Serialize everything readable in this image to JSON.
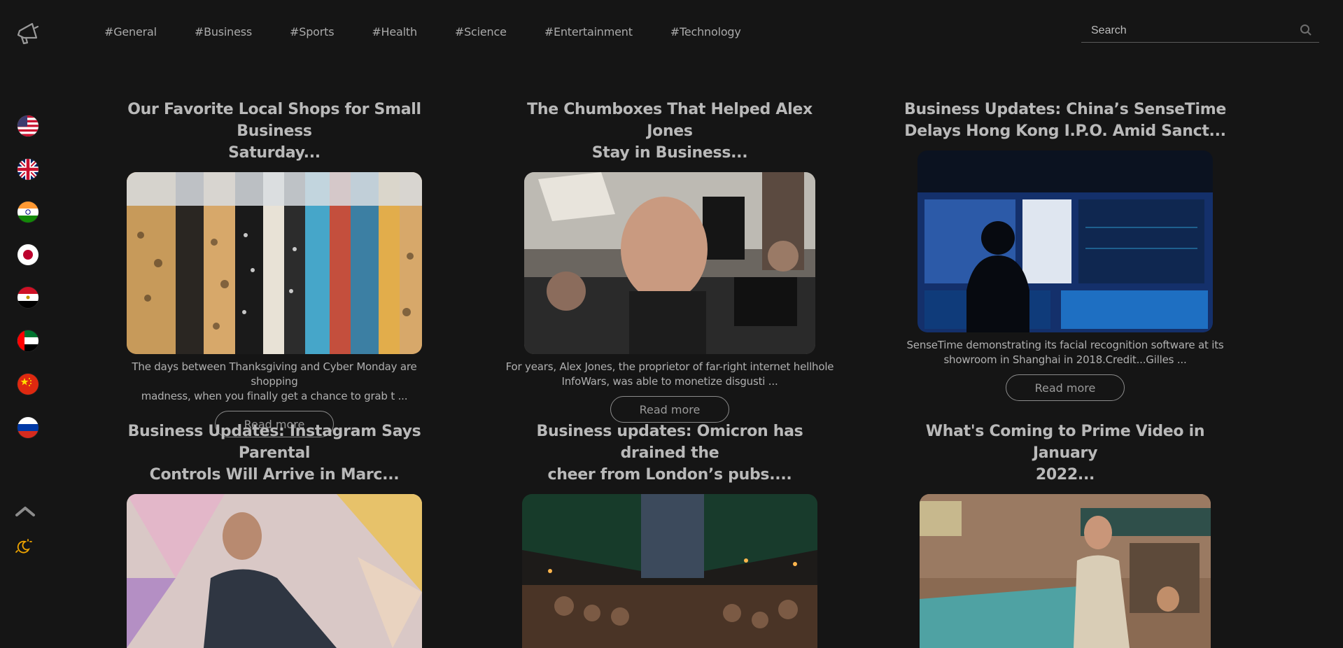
{
  "nav": {
    "logo_icon": "megaphone-icon",
    "categories": [
      "#General",
      "#Business",
      "#Sports",
      "#Health",
      "#Science",
      "#Entertainment",
      "#Technology"
    ]
  },
  "search": {
    "placeholder": "Search",
    "value": "",
    "icon": "search-icon"
  },
  "sidebar": {
    "countries": [
      {
        "code": "us",
        "icon": "flag-us-icon"
      },
      {
        "code": "gb",
        "icon": "flag-uk-icon"
      },
      {
        "code": "in",
        "icon": "flag-india-icon"
      },
      {
        "code": "jp",
        "icon": "flag-japan-icon"
      },
      {
        "code": "eg",
        "icon": "flag-egypt-icon"
      },
      {
        "code": "ae",
        "icon": "flag-uae-icon"
      },
      {
        "code": "cn",
        "icon": "flag-china-icon"
      },
      {
        "code": "ru",
        "icon": "flag-russia-icon"
      }
    ],
    "scroll_top_icon": "chevron-up-icon",
    "theme_toggle_icon": "moon-sun-icon"
  },
  "articles": [
    {
      "title_line1": "Our Favorite Local Shops for Small Business",
      "title_line2": "Saturday...",
      "desc_line1": "The days between Thanksgiving and Cyber Monday are shopping",
      "desc_line2": "madness, when you finally get a chance to grab t ...",
      "read_more": "Read more",
      "image": "clothing-rack-image"
    },
    {
      "title_line1": "The Chumboxes That Helped Alex Jones",
      "title_line2": "Stay in Business...",
      "desc_line1": "For years, Alex Jones, the proprietor of far-right internet hellhole",
      "desc_line2": "InfoWars, was able to monetize disgusti ...",
      "read_more": "Read more",
      "image": "protest-crowd-image"
    },
    {
      "title_line1": "Business Updates: China’s SenseTime",
      "title_line2": "Delays Hong Kong I.P.O. Amid Sanct...",
      "desc_line1": "SenseTime demonstrating its facial recognition software at its",
      "desc_line2": "showroom in Shanghai in 2018.Credit...Gilles ...",
      "read_more": "Read more",
      "image": "surveillance-screens-image"
    },
    {
      "title_line1": "Business Updates: Instagram Says Parental",
      "title_line2": "Controls Will Arrive in Marc...",
      "image": "man-in-dome-image"
    },
    {
      "title_line1": "Business updates: Omicron has drained the",
      "title_line2": "cheer from London’s pubs....",
      "image": "london-pub-street-image"
    },
    {
      "title_line1": "What's Coming to Prime Video in January",
      "title_line2": "2022...",
      "image": "man-leaning-car-image"
    }
  ],
  "colors": {
    "background": "#151515",
    "text": "#b9b9b9",
    "accent": "#f0a500"
  }
}
